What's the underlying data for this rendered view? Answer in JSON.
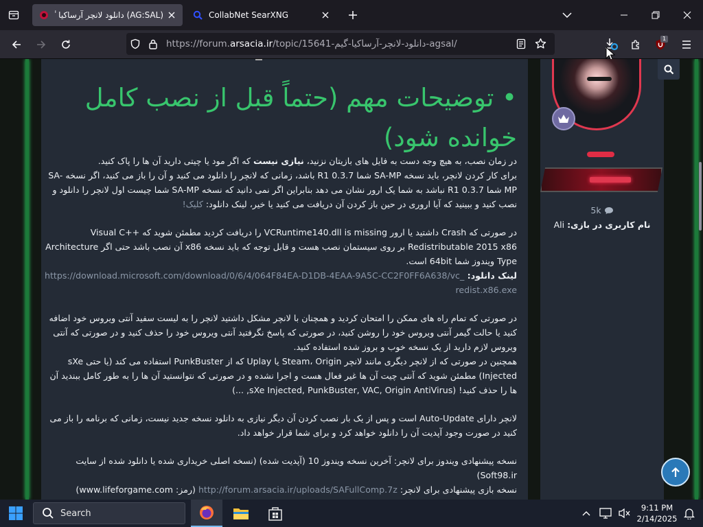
{
  "browser": {
    "tabs": [
      {
        "title": "(AG:SAL) دانلود لانچر آرساکیا گیم",
        "active": true
      },
      {
        "title": "CollabNet SearXNG",
        "active": false
      }
    ],
    "url": {
      "prefix": "https://forum.",
      "domain": "arsacia.ir",
      "path": "/topic/15641-دانلود-لانچر-آرساکیا-گیم-agsal/"
    },
    "extension_badge": "1"
  },
  "post": {
    "heading": "توضیحات مهم (حتماً قبل از نصب کامل خوانده شود)",
    "p1": {
      "a": "در زمان نصب، به هیچ وجه دست به فایل های بازیتان نزنید، ",
      "b": "نیازی نیست",
      "c": " که اگر مود یا چیتی دارید آن ها را پاک کنید.",
      "d": "برای کار کردن لانچر، باید نسخه SA-MP شما R1 0.3.7 باشد، زمانی که لانچر را دانلود می کنید و آن را باز می کنید، اگر نسخه SA-MP شما R1 0.3.7 نباشد به شما یک ارور نشان می دهد بنابراین اگر نمی دانید که نسخه SA-MP شما چیست اول لانچر را دانلود و نصب کنید و ببینید که آیا اروری در حین باز کردن آن دریافت می کنید یا خیر، لینک دانلود: ",
      "e": "کلیک!"
    },
    "p2": {
      "a": "در صورتی که Crash داشتید یا ارور VCRuntime140.dll is missing را دریافت کردید مطمئن شوید که Visual C++ Redistributable 2015 x86 بر روی سیستمان نصب هست و قابل توجه که باید نسخه x86 آن نصب باشد حتی اگر Architecture Type ویندوز شما 64bit است.",
      "b": "لینک دانلود: ",
      "c": "https://download.microsoft.com/download/0/6/4/064F84EA-D1DB-4EAA-9A5C-CC2F0FF6A638/vc_redist.x86.exe"
    },
    "p3": {
      "a": "در صورتی که تمام راه های ممکن را امتحان کردید و همچنان با لانچر مشکل داشتید لانچر را به لیست سفید آنتی ویروس خود اضافه کنید یا حالت گیمر آنتی ویروس خود را روشن کنید، در صورتی که پاسخ نگرفتید آنتی ویروس خود را حذف کنید و در صورتی که آنتی ویروس لازم دارید از یک نسخه خوب و بروز شده استفاده کنید.",
      "b": "همچنین در صورتی که از لانچر دیگری مانند لانچر Steam، Origin یا Uplay که از PunkBuster استفاده می کند (یا حتی sXe Injected) مطمئن شوید که آنتی چیت آن ها غیر فعال هست و اجرا نشده و در صورتی که نتوانستید آن ها را به طور کامل ببندید آن ها را حذف کنید! (sXe Injected, PunkBuster, VAC, Origin AntiVirus, ...)"
    },
    "p4": "لانچر دارای Auto-Update است و پس از یک بار نصب کردن آن دیگر نیازی به دانلود نسخه جدید نیست، زمانی که برنامه را باز می کنید در صورت وجود آپدیت آن را دانلود خواهد کرد و برای شما قرار خواهد داد.",
    "p5": {
      "a": "نسخه پیشنهادی ویندوز برای لانچر: آخرین نسخه ویندوز 10 (آپدیت شده) (نسخه اصلی خریداری شده یا دانلود شده از سایت Soft98.ir)",
      "b": "نسخه بازی پیشنهادی برای لانچر: ",
      "c": "http://forum.arsacia.ir/uploads/SAFullComp.7z",
      "d": " (رمز: www.lifeforgame.com)"
    }
  },
  "author": {
    "reputation": "5k",
    "ingame_label": "نام کاربری در بازی:",
    "ingame_name": "Ali"
  },
  "taskbar": {
    "search_placeholder": "Search",
    "time": "9:11 PM",
    "date": "2/14/2025"
  },
  "colors": {
    "heading": "#38c56d",
    "post_bg": "#242b36",
    "accent": "#2a79b8"
  }
}
